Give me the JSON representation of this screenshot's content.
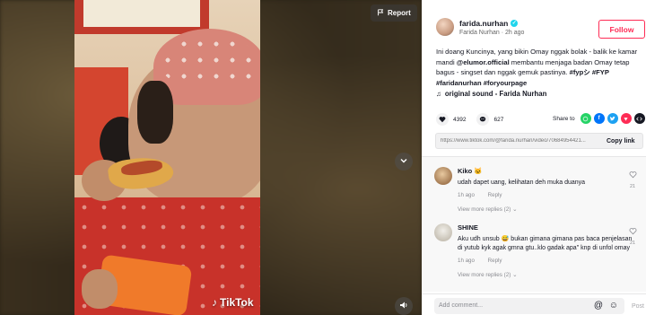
{
  "video": {
    "report_label": "Report",
    "watermark": "TikTok"
  },
  "author": {
    "username": "farida.nurhan",
    "display_name": "Farida Nurhan",
    "time_ago": "2h ago",
    "follow_label": "Follow"
  },
  "caption": {
    "text_before": "Ini doang Kuncinya, yang bikin Omay nggak bolak - balik ke kamar mandi ",
    "mention": "@elumor.official",
    "text_after": " membantu menjaga badan Omay tetap bagus - singset dan nggak gemuk pastinya. ",
    "tags": "#fypシ #FYP #faridanurhan #foryourpage"
  },
  "sound": {
    "label": "original sound - Farida Nurhan"
  },
  "stats": {
    "likes": "4392",
    "comments": "627"
  },
  "share": {
    "label": "Share to",
    "targets": [
      "whatsapp",
      "facebook",
      "twitter",
      "pinterest",
      "embed"
    ]
  },
  "link": {
    "url": "https://www.tiktok.com/@farida.nurhan/video/70684954421...",
    "copy_label": "Copy link"
  },
  "comments": [
    {
      "name": "Kiko 🐱",
      "text": "udah dapet uang, kelihatan deh muka duanya",
      "time": "1h ago",
      "reply_label": "Reply",
      "likes": "21",
      "more_replies": "View more replies (2)"
    },
    {
      "name": "SHINE",
      "text": "Aku udh unsub 😅 bukan gimana gimana pas baca penjelasan di yutub kyk agak gmna gtu..klo gadak apa\" knp di unfol omay",
      "time": "1h ago",
      "reply_label": "Reply",
      "likes": "21",
      "more_replies": "View more replies (2)"
    }
  ],
  "add_comment": {
    "placeholder": "Add comment...",
    "post_label": "Post"
  },
  "colors": {
    "accent": "#fe2c55",
    "verified": "#20d5ec"
  }
}
